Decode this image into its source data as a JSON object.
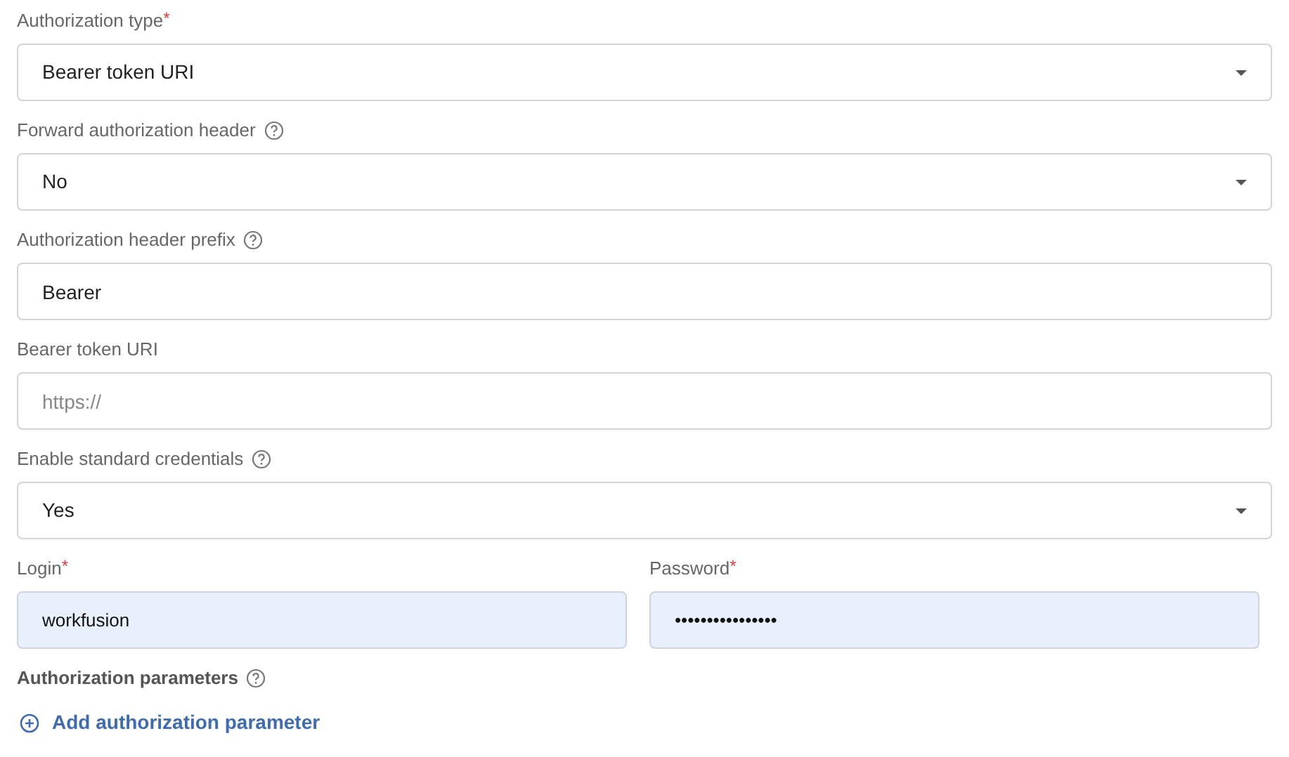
{
  "fields": [
    {
      "kind": "select",
      "label": "Authorization type",
      "required_mark": "*",
      "help": false,
      "value": "Bearer token URI"
    },
    {
      "kind": "select",
      "label": "Forward authorization header",
      "help": true,
      "value": "No"
    },
    {
      "kind": "text",
      "label": "Authorization header prefix",
      "help": true,
      "value": "Bearer"
    },
    {
      "kind": "text",
      "label": "Bearer token URI",
      "help": false,
      "placeholder": "https://"
    },
    {
      "kind": "select",
      "label": "Enable standard credentials",
      "help": true,
      "value": "Yes"
    }
  ],
  "credentials": [
    {
      "label": "Login",
      "required_mark": "*",
      "value": "workfusion",
      "autofilled": true
    },
    {
      "label": "Password",
      "required_mark": "*",
      "value": "••••••••••••••••",
      "autofilled": true
    }
  ],
  "parameters": {
    "label": "Authorization parameters",
    "help": true
  },
  "add_link": "Add authorization parameter"
}
